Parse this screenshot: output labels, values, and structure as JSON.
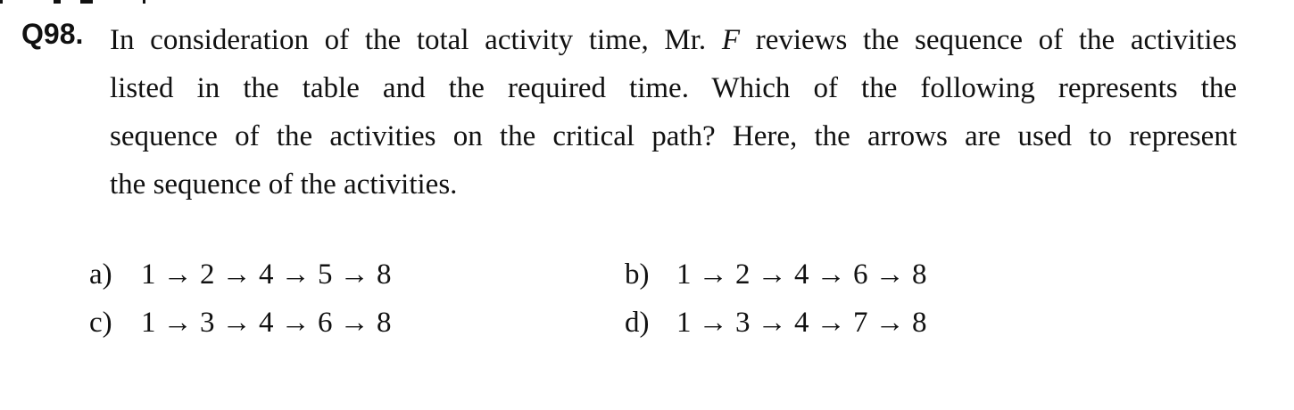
{
  "question": {
    "number": "Q98.",
    "lines": [
      {
        "before": "In consideration of the total activity time, Mr. ",
        "italic": "F",
        "after": " reviews the sequence of the activities"
      },
      {
        "before": "listed in the table and the required time.   Which of the following represents the",
        "italic": "",
        "after": ""
      },
      {
        "before": "sequence of the activities on the critical path?   Here, the arrows are used to represent",
        "italic": "",
        "after": ""
      },
      {
        "before": "the sequence of the activities.",
        "italic": "",
        "after": ""
      }
    ]
  },
  "options": [
    {
      "letter": "a)",
      "text": "1 → 2 → 4 → 5 → 8"
    },
    {
      "letter": "b)",
      "text": "1 → 2 → 4 → 6 → 8"
    },
    {
      "letter": "c)",
      "text": "1 → 3 → 4 → 6 → 8"
    },
    {
      "letter": "d)",
      "text": "1 → 3 → 4 → 7 → 8"
    }
  ]
}
